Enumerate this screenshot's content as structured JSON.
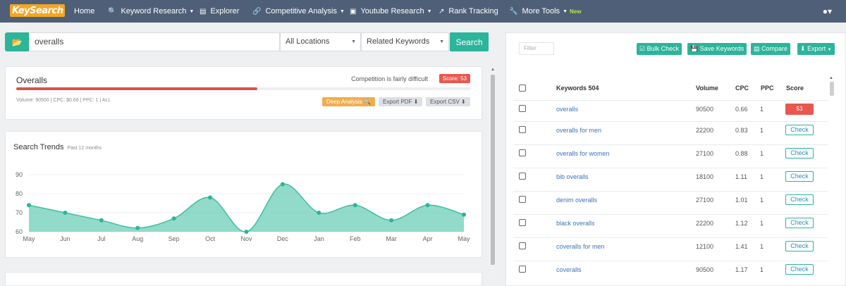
{
  "nav": {
    "logo": "KeySearch",
    "items": [
      {
        "label": "Home",
        "icon": "home",
        "caret": false
      },
      {
        "label": "Keyword Research",
        "icon": "search-icon",
        "caret": true
      },
      {
        "label": "Explorer",
        "icon": "bar-chart-icon",
        "caret": false
      },
      {
        "label": "Competitive Analysis",
        "icon": "link-icon",
        "caret": true
      },
      {
        "label": "Youtube Research",
        "icon": "video-icon",
        "caret": true
      },
      {
        "label": "Rank Tracking",
        "icon": "line-chart-icon",
        "caret": false
      },
      {
        "label": "More Tools",
        "icon": "wrench-icon",
        "caret": true,
        "badge": "New"
      }
    ]
  },
  "search": {
    "keyword": "overalls",
    "location": "All Locations",
    "mode": "Related Keywords",
    "button": "Search"
  },
  "overview": {
    "title": "Overalls",
    "competition": "Competition is fairly difficult",
    "score": "Score: 53",
    "difficulty": 53,
    "meta": "Volume: 90500 | CPC: $0.66 | PPC: 1 | ALL",
    "deep_analysis": "Deep Analysis",
    "export_pdf": "Export PDF",
    "export_csv": "Export CSV"
  },
  "trends": {
    "title": "Search Trends",
    "subtitle": "Past 12 months"
  },
  "chart_data": {
    "type": "area",
    "x": [
      "May",
      "Jun",
      "Jul",
      "Aug",
      "Sep",
      "Oct",
      "Nov",
      "Dec",
      "Jan",
      "Feb",
      "Mar",
      "Apr",
      "May"
    ],
    "values": [
      74,
      70,
      66,
      62,
      67,
      78,
      60,
      85,
      70,
      74,
      66,
      74,
      69
    ],
    "yticks": [
      60,
      70,
      80,
      90
    ],
    "ylim": [
      60,
      90
    ],
    "grid": true,
    "color": "#7fd3c1"
  },
  "right": {
    "filter_placeholder": "Filter",
    "buttons": [
      "Bulk Check",
      "Save Keywords",
      "Compare",
      "Export"
    ],
    "headers": {
      "keywords": "Keywords 504",
      "volume": "Volume",
      "cpc": "CPC",
      "ppc": "PPC",
      "score": "Score"
    },
    "check_label": "Check",
    "rows": [
      {
        "keyword": "overalls",
        "volume": "90500",
        "cpc": "0.66",
        "ppc": "1",
        "score": "53"
      },
      {
        "keyword": "overalls for men",
        "volume": "22200",
        "cpc": "0.83",
        "ppc": "1",
        "score": ""
      },
      {
        "keyword": "overalls for women",
        "volume": "27100",
        "cpc": "0.88",
        "ppc": "1",
        "score": ""
      },
      {
        "keyword": "bib overalls",
        "volume": "18100",
        "cpc": "1.11",
        "ppc": "1",
        "score": ""
      },
      {
        "keyword": "denim overalls",
        "volume": "27100",
        "cpc": "1.01",
        "ppc": "1",
        "score": ""
      },
      {
        "keyword": "black overalls",
        "volume": "22200",
        "cpc": "1.12",
        "ppc": "1",
        "score": ""
      },
      {
        "keyword": "coveralls for men",
        "volume": "12100",
        "cpc": "1.41",
        "ppc": "1",
        "score": ""
      },
      {
        "keyword": "coveralls",
        "volume": "90500",
        "cpc": "1.17",
        "ppc": "1",
        "score": ""
      }
    ]
  }
}
